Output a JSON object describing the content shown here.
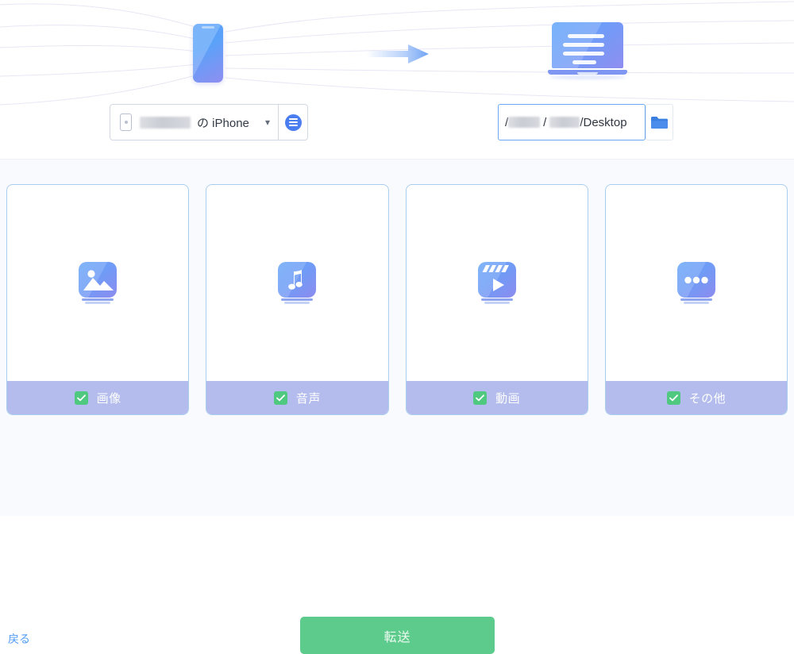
{
  "hero": {
    "source_device_icon": "phone-illustration",
    "transfer_arrow_icon": "arrow-right",
    "target_device_icon": "laptop-illustration"
  },
  "source": {
    "device_icon": "phone-icon",
    "device_name_redacted": "",
    "device_label": "の iPhone",
    "caret_icon": "chevron-down-icon",
    "menu_icon": "list-circle-icon"
  },
  "destination": {
    "path_prefix": "/",
    "path_separator": "/",
    "path_tail": "/Desktop",
    "browse_icon": "folder-icon"
  },
  "categories": [
    {
      "label": "画像",
      "icon": "image-icon",
      "checked": true
    },
    {
      "label": "音声",
      "icon": "music-note-icon",
      "checked": true
    },
    {
      "label": "動画",
      "icon": "video-icon",
      "checked": true
    },
    {
      "label": "その他",
      "icon": "more-dots-icon",
      "checked": true
    }
  ],
  "actions": {
    "back_label": "戻る",
    "transfer_label": "転送"
  },
  "colors": {
    "accent_blue": "#4a7ef0",
    "card_border": "#a9cdee",
    "footer_bar": "#b3bcec",
    "checkbox_green": "#4fc97f",
    "transfer_green": "#5dcb8b",
    "link_blue": "#4f9bf5",
    "page_background": "#f8fafd"
  }
}
